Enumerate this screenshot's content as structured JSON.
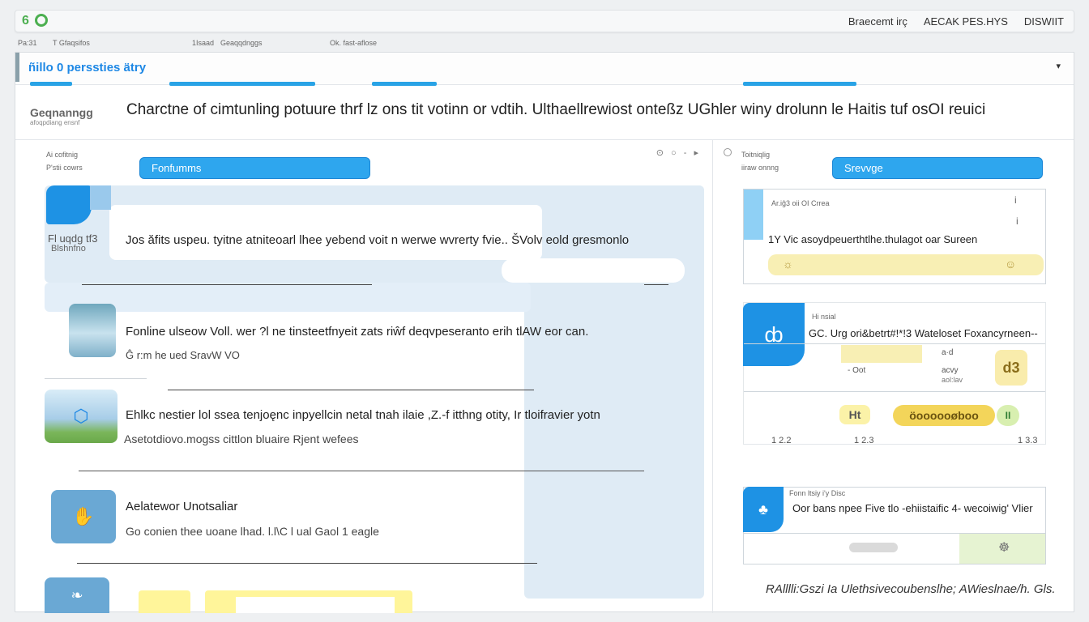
{
  "app": {
    "logo_text": "6",
    "top_links": [
      "Braecemt irç",
      "AECAK PES.HYS",
      "DISWIIT"
    ],
    "sub_items": [
      "Pa:31",
      "T Gfaqsifos",
      "1Isaad",
      "Geaqqdnggs",
      "Ok. fast-aflose"
    ]
  },
  "window": {
    "title": "ñillo 0 perssties ätry",
    "caret": "▾"
  },
  "description": {
    "label": "Geqnanngg",
    "sublabel": "afoqpdiang ensnf",
    "text": "Charctne of cimtunling potuure thrf lz ons tit votinn or vdtih. Ulthaellrewiost onteßz UGhler winy drolunn le Haitis tuf osOI reuici"
  },
  "left_panel": {
    "meta": [
      "Ai cofitnig",
      "P'stii cowrs"
    ],
    "tab_label": "Fonfumms",
    "icons": "⊙ ○ - ▸",
    "items": [
      {
        "icon_name": "user-bubble-icon",
        "caption": "Fl uqdg tf3",
        "caption2": "Blshnfno",
        "line1": "Jos ăfits uspeu. tyitne atniteoarl lhee yebend voit n werwe wvrerty fvie.. ŠVolv eold gresmonlo",
        "line2": ""
      },
      {
        "icon_name": "landscape-icon",
        "caption": "",
        "caption2": "",
        "line1": "Fonline ulseow Voll. wer ?l ne tinsteetfnyeit zats riŵf deqvpeseranto erih tlAW eor can.",
        "line2": "Ĝ r:m he ued SravW VO"
      },
      {
        "icon_name": "water-drop-icon",
        "caption": "",
        "caption2": "",
        "line1": "Ehlkc nestier lol ssea tenjoęnc inpyellcin netal tnah ilaie ,Z.-f itthng otity, Ir tloifravier yotn",
        "line2": "Asetotdiovo.mogss cittlon bluaire Rjent wefees"
      },
      {
        "icon_name": "hand-icon",
        "caption": "",
        "caption2": "",
        "line1": "Aelatewor Unotsaliar",
        "line2": "Go conien thee uoane lhad. l.l\\C l ual Gaol 1 eagle"
      },
      {
        "icon_name": "leaf-icon",
        "caption": "",
        "caption2": "",
        "line1": "",
        "line2": ""
      }
    ]
  },
  "right_panel": {
    "meta": [
      "Toitniqlig",
      "iiraw onnng"
    ],
    "tab_label": "Srevvge",
    "card1": {
      "label": "Ar.iĝ3 oii OI Crrea",
      "line": "1Y Vic asoydpeuerthtlhe.thulagot oar Sureen",
      "tick_a": "i",
      "tick_b": "i"
    },
    "card2": {
      "label": "Hi nsial",
      "line": "GC. Urg ori&betrt#!*!3 Wateloset Foxancyrneen--",
      "sub_a": "a·d",
      "sub_b": "- Oot",
      "sub_c": "acvy",
      "sub_d": "aol:lav",
      "badge": "d3",
      "badge_label": "Ht",
      "chip_text": "öoooooøboo",
      "chip_end": "II",
      "ticks": [
        "1 2.2",
        "1 2.3",
        "1 3.3"
      ]
    },
    "card3": {
      "label": "Fonn ltsiy i'y Disc",
      "line": "Oor bans npee Five tlo -ehiistaific 4- wecoiwig' Vlier"
    },
    "footer_note": "RAlllli:Gszi Ia Ulethsivecoubenslhe; AWieslnae/h. Gls."
  },
  "colors": {
    "accent": "#2ea6ee",
    "brand": "#4caf50",
    "title": "#1e88e5"
  }
}
